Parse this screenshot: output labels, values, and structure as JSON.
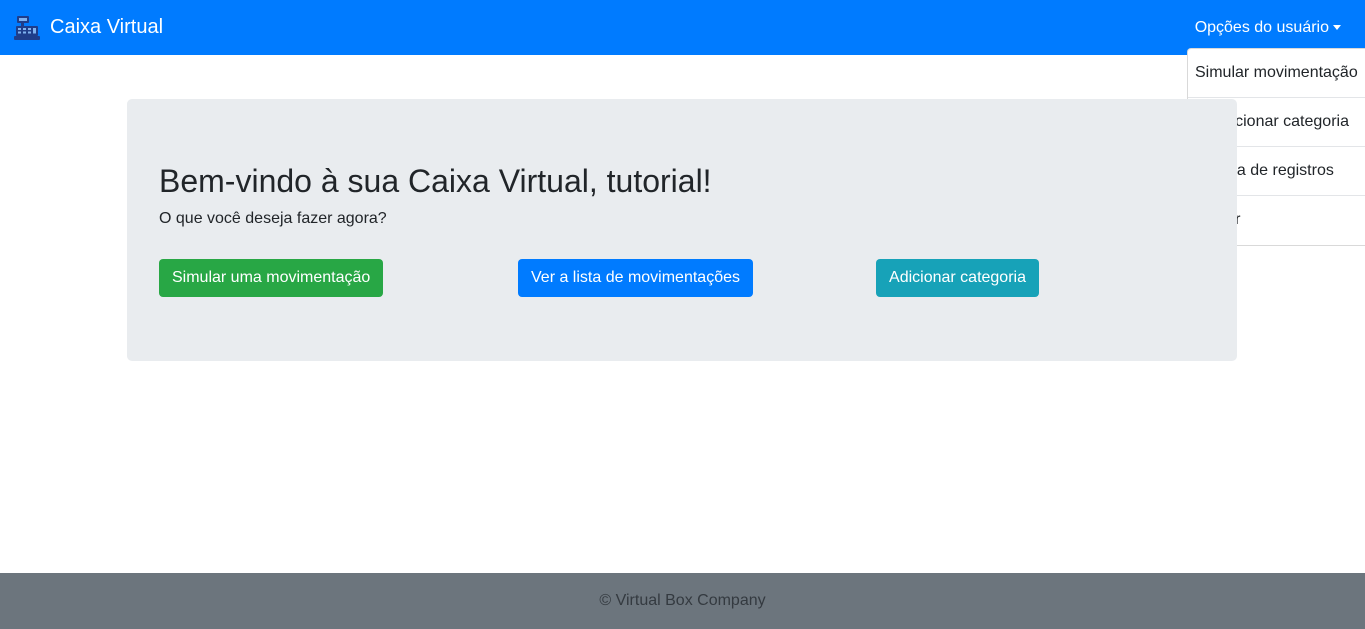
{
  "navbar": {
    "brand_icon": "cash-register-icon",
    "brand_text": "Caixa Virtual",
    "user_menu_label": "Opções do usuário",
    "caret_icon": "caret-down-icon",
    "color": "#007bff"
  },
  "dropdown": {
    "items": [
      {
        "label": "Simular movimentação"
      },
      {
        "label": "Adicionar categoria"
      },
      {
        "label": "Lista de registros"
      },
      {
        "label": "Sair"
      }
    ]
  },
  "main": {
    "title": "Bem-vindo à sua Caixa Virtual, tutorial!",
    "subtitle": "O que você deseja fazer agora?",
    "buttons": {
      "simulate": {
        "label": "Simular uma movimentação",
        "color": "#28a745"
      },
      "list": {
        "label": "Ver a lista de movimentações",
        "color": "#007bff"
      },
      "category": {
        "label": "Adicionar categoria",
        "color": "#17a2b8"
      }
    }
  },
  "footer": {
    "text": "© Virtual Box Company",
    "color": "#6c757d"
  }
}
